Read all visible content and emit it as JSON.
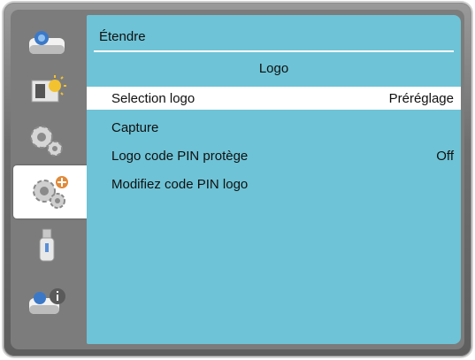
{
  "menu": {
    "title": "Étendre",
    "section": "Logo",
    "rows": [
      {
        "label": "Selection logo",
        "value": "Préréglage"
      },
      {
        "label": "Capture",
        "value": ""
      },
      {
        "label": "Logo code PIN protège",
        "value": "Off"
      },
      {
        "label": "Modifiez code PIN logo",
        "value": ""
      }
    ],
    "selected_index": 0
  },
  "sidebar": {
    "icons": [
      "projector-icon",
      "image-adjust-icon",
      "settings-gear-icon",
      "extended-settings-gear-plus-icon",
      "usb-icon",
      "info-projector-icon"
    ],
    "active_index": 3
  },
  "colors": {
    "panel_bg": "#6ec3d6",
    "frame": "#6f6f6f",
    "selected_row_bg": "#ffffff"
  }
}
